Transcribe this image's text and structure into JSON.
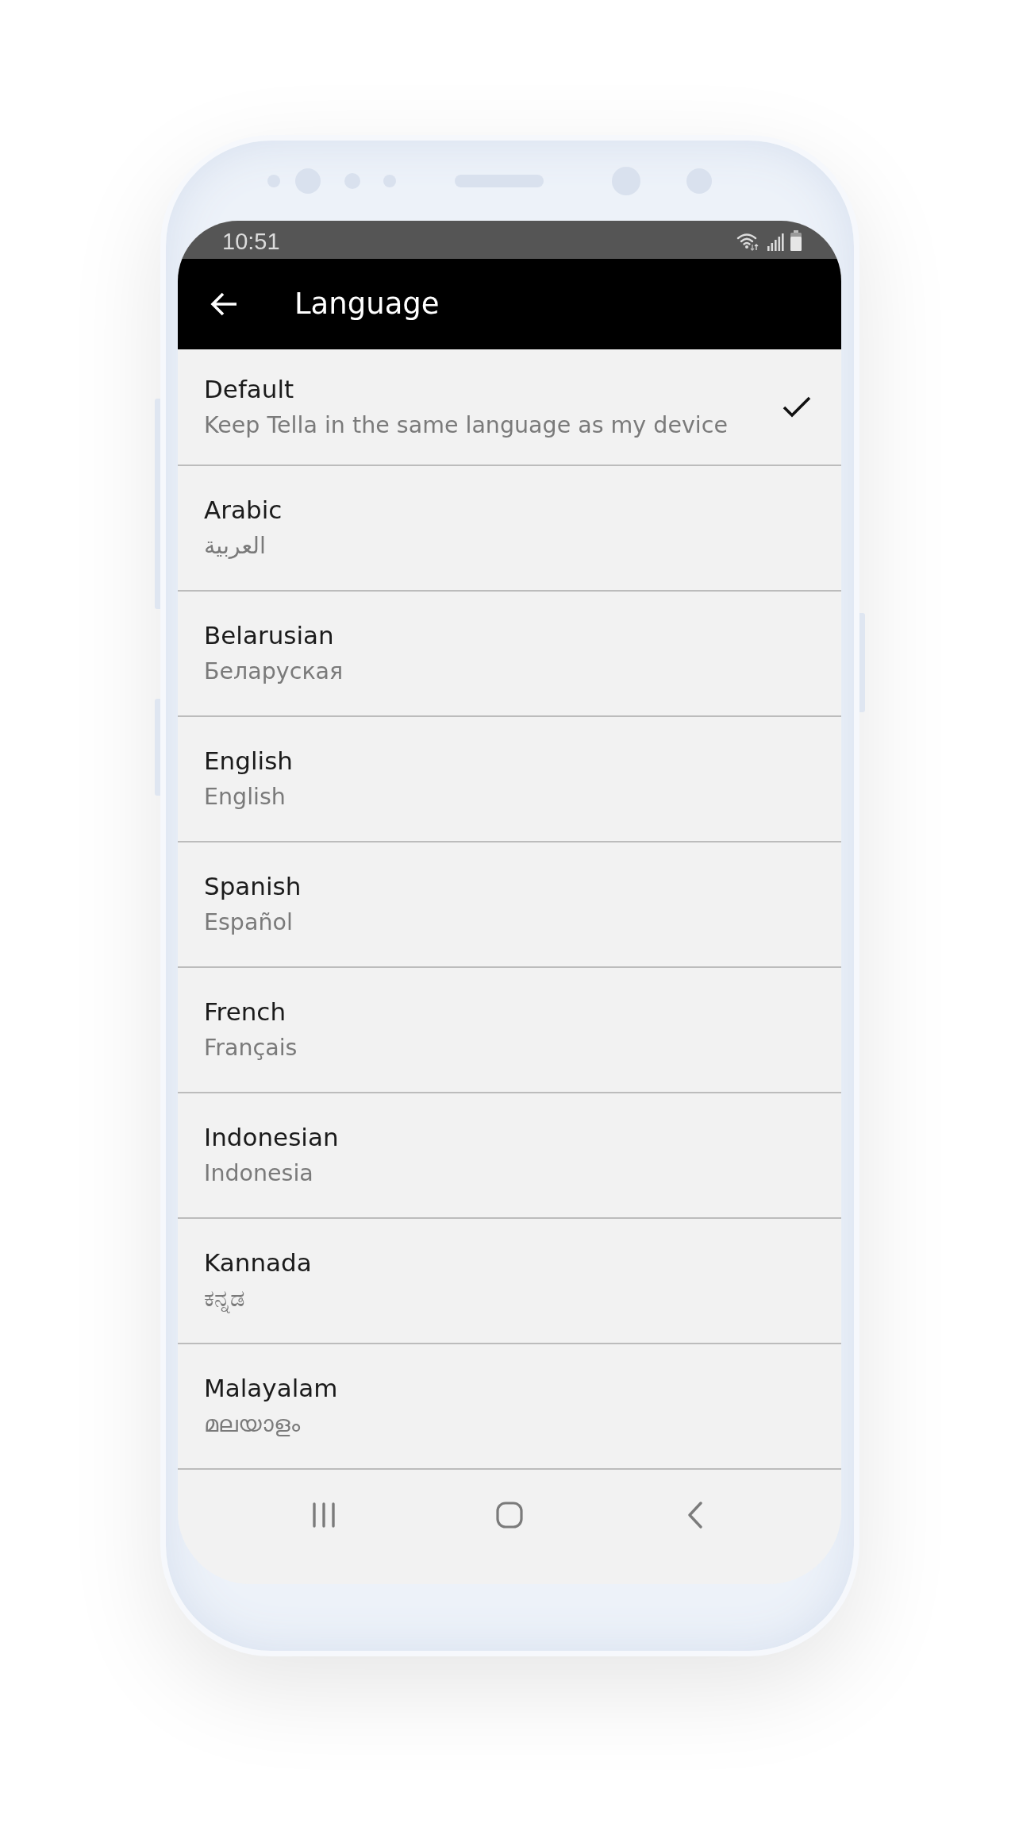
{
  "status_bar": {
    "time": "10:51"
  },
  "app_bar": {
    "title": "Language"
  },
  "languages": [
    {
      "name": "Default",
      "native": "Keep Tella in the same language as my device",
      "selected": true
    },
    {
      "name": "Arabic",
      "native": "العربية",
      "selected": false
    },
    {
      "name": "Belarusian",
      "native": "Беларуская",
      "selected": false
    },
    {
      "name": "English",
      "native": "English",
      "selected": false
    },
    {
      "name": "Spanish",
      "native": "Español",
      "selected": false
    },
    {
      "name": "French",
      "native": "Français",
      "selected": false
    },
    {
      "name": "Indonesian",
      "native": "Indonesia",
      "selected": false
    },
    {
      "name": "Kannada",
      "native": "ಕನ್ನಡ",
      "selected": false
    },
    {
      "name": "Malayalam",
      "native": "മലയാളം",
      "selected": false
    }
  ]
}
